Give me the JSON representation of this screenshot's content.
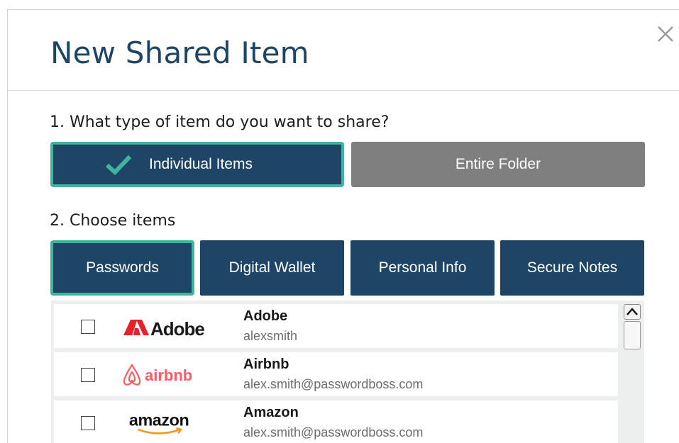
{
  "dialog": {
    "title": "New Shared Item",
    "close_icon": "close-icon"
  },
  "step1": {
    "label": "1.  What type of item do you want to share?",
    "options": [
      {
        "label": "Individual Items",
        "selected": true,
        "icon": "checkmark-icon"
      },
      {
        "label": "Entire Folder",
        "selected": false
      }
    ]
  },
  "step2": {
    "label": "2.  Choose items",
    "tabs": [
      {
        "label": "Passwords",
        "active": true
      },
      {
        "label": "Digital Wallet",
        "active": false
      },
      {
        "label": "Personal Info",
        "active": false
      },
      {
        "label": "Secure Notes",
        "active": false
      }
    ]
  },
  "items": [
    {
      "name": "Adobe",
      "username": "alexsmith",
      "logo_text": "Adobe",
      "logo": "adobe-logo",
      "checked": false
    },
    {
      "name": "Airbnb",
      "username": "alex.smith@passwordboss.com",
      "logo_text": "airbnb",
      "logo": "airbnb-logo",
      "checked": false
    },
    {
      "name": "Amazon",
      "username": "alex.smith@passwordboss.com",
      "logo_text": "amazon",
      "logo": "amazon-logo",
      "checked": false
    }
  ],
  "colors": {
    "primary": "#1f4566",
    "accent": "#3fb39b",
    "inactive": "#7f7f7f",
    "adobe_red": "#e8202a",
    "airbnb_pink": "#ff5a5f",
    "amazon_orange": "#f29a1f"
  }
}
